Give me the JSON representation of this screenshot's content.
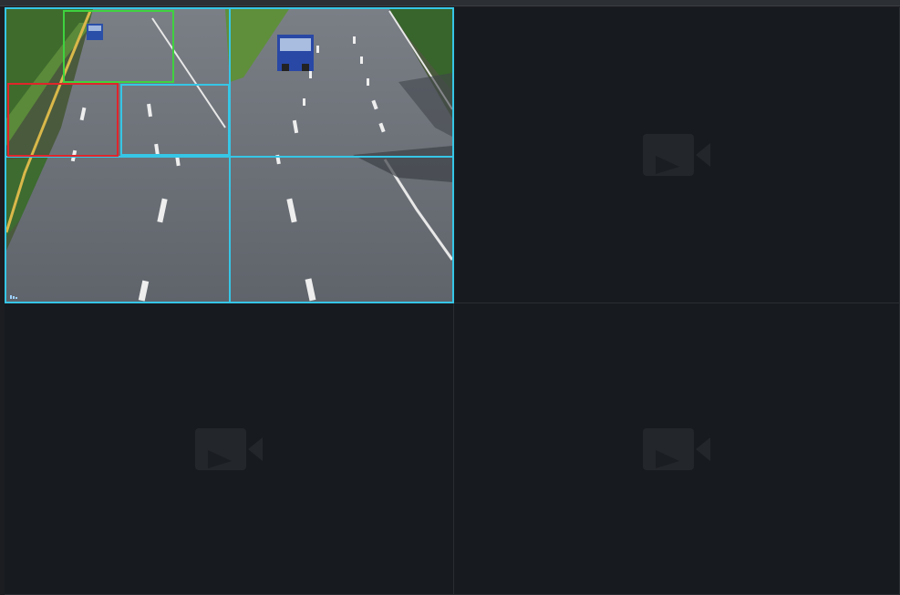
{
  "window": {
    "layout": "2x2",
    "accent_color": "#36c6e6"
  },
  "channels": [
    {
      "state": "live",
      "selected": true,
      "content": "road-traffic-feed",
      "zones": [
        {
          "name": "detection-zone-green",
          "color": "#3fd23f"
        },
        {
          "name": "detection-zone-red",
          "color": "#e0252b"
        },
        {
          "name": "detection-zone-cyan",
          "color": "#36c6e6"
        }
      ],
      "icon": "camera-feed"
    },
    {
      "state": "no-signal",
      "selected": false,
      "icon": "camera-icon"
    },
    {
      "state": "no-signal",
      "selected": false,
      "icon": "camera-icon"
    },
    {
      "state": "no-signal",
      "selected": false,
      "icon": "camera-icon"
    }
  ]
}
